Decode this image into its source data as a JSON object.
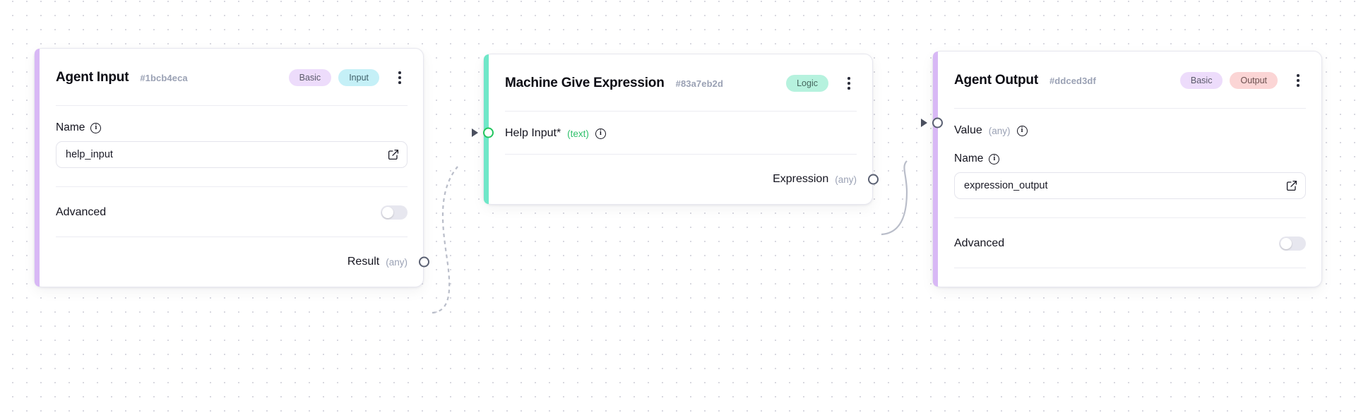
{
  "canvas": {
    "background": "#ffffff",
    "dot_color": "#d8d8e0"
  },
  "nodes": [
    {
      "id": "agent-input",
      "title": "Agent Input",
      "node_id": "#1bcb4eca",
      "accent_color": "#d8b8f5",
      "badges": [
        {
          "label": "Basic",
          "color": "#eddcfb"
        },
        {
          "label": "Input",
          "color": "#c5f0f7"
        }
      ],
      "menu_icon": "kebab-menu-icon",
      "fields": {
        "name_label": "Name",
        "name_value": "help_input",
        "name_info_icon": "info-icon",
        "edit_icon": "edit-square-icon",
        "advanced_label": "Advanced",
        "advanced_toggle_state": "off"
      },
      "output_port": {
        "label": "Result",
        "type": "(any)",
        "type_color": "#9aa1b4"
      }
    },
    {
      "id": "machine-give-expression",
      "title": "Machine Give Expression",
      "node_id": "#83a7eb2d",
      "accent_color": "#6fe7c8",
      "badges": [
        {
          "label": "Logic",
          "color": "#b6f2de"
        }
      ],
      "menu_icon": "kebab-menu-icon",
      "input_port": {
        "label": "Help Input*",
        "type": "(text)",
        "type_color": "#2fc16b",
        "info_icon": "info-icon",
        "port_color": "#22c55e"
      },
      "output_port": {
        "label": "Expression",
        "type": "(any)",
        "type_color": "#9aa1b4"
      }
    },
    {
      "id": "agent-output",
      "title": "Agent Output",
      "node_id": "#ddced3df",
      "accent_color": "#d8b8f5",
      "badges": [
        {
          "label": "Basic",
          "color": "#eddcfb"
        },
        {
          "label": "Output",
          "color": "#fbd5d5"
        }
      ],
      "menu_icon": "kebab-menu-icon",
      "input_port": {
        "label": "Value",
        "type": "(any)",
        "type_color": "#9aa1b4",
        "info_icon": "info-icon"
      },
      "fields": {
        "name_label": "Name",
        "name_value": "expression_output",
        "name_info_icon": "info-icon",
        "edit_icon": "edit-square-icon",
        "advanced_label": "Advanced",
        "advanced_toggle_state": "off"
      }
    }
  ],
  "edges": [
    {
      "name": "edge-result-to-help-input",
      "from": "agent-input.Result",
      "to": "machine-give-expression.Help Input*",
      "style": "dashed",
      "color": "#b9bdc9"
    },
    {
      "name": "edge-expression-to-value",
      "from": "machine-give-expression.Expression",
      "to": "agent-output.Value",
      "style": "solid",
      "color": "#b9bdc9"
    }
  ]
}
